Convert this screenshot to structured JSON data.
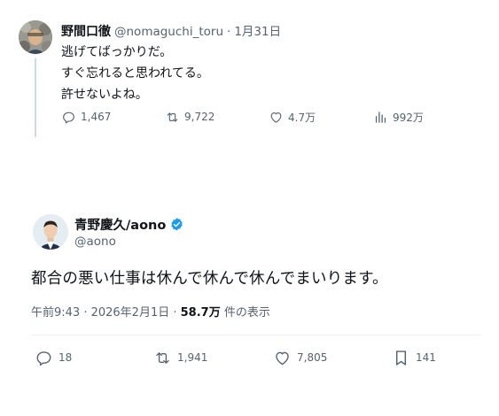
{
  "quoted_tweet": {
    "author_name": "野間口徹",
    "handle": "@nomaguchi_toru",
    "separator": "·",
    "date": "1月31日",
    "lines": [
      "逃げてばっかりだ。",
      "すぐ忘れると思われてる。",
      "許せないよね。"
    ],
    "stats": {
      "replies": "1,467",
      "retweets": "9,722",
      "likes": "4.7万",
      "views": "992万"
    }
  },
  "main_tweet": {
    "author_name": "青野慶久/aono",
    "handle": "@aono",
    "text": "都合の悪い仕事は休んで休んで休んでまいります。",
    "time": "午前9:43 · 2026年2月1日 · ",
    "views": "58.7万",
    "views_label": " 件の表示",
    "stats": {
      "replies": "18",
      "retweets": "1,941",
      "likes": "7,805",
      "bookmarks": "141"
    }
  },
  "icons": {
    "reply": "reply-icon",
    "retweet": "retweet-icon",
    "like": "heart-icon",
    "views": "views-icon",
    "bookmark": "bookmark-icon",
    "verified": "verified-badge-icon"
  },
  "colors": {
    "verified": "#1d9bf0",
    "secondary_text": "#536471",
    "text": "#0f1419"
  }
}
